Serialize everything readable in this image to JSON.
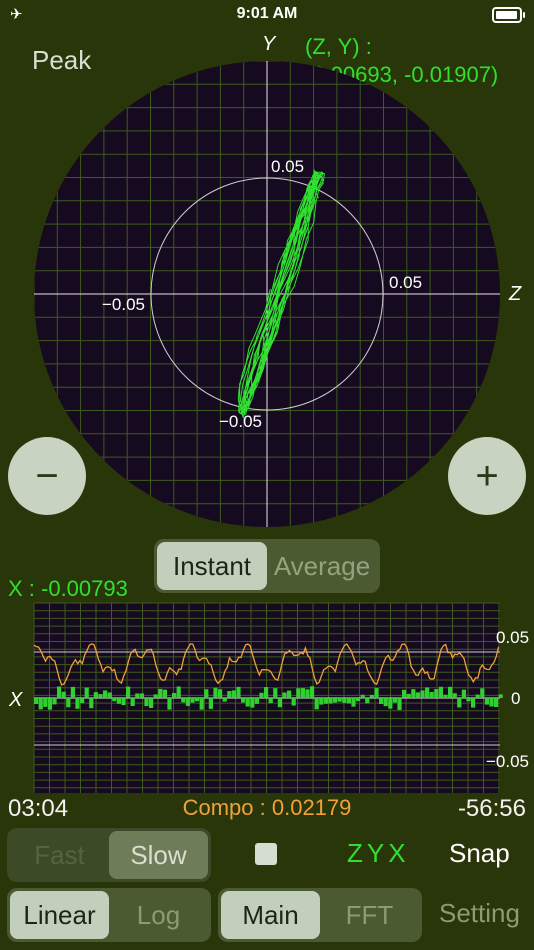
{
  "status": {
    "time": "9:01 AM",
    "left_icons": "✈",
    "battery": 0.95
  },
  "header": {
    "mode_label": "Peak",
    "zy_caption": "(Z, Y) :",
    "zy_value": "(0.00693, -0.01907)"
  },
  "polar": {
    "axis_y": "Y",
    "axis_z": "Z",
    "tick_top": "0.05",
    "tick_right": "0.05",
    "tick_left": "−0.05",
    "tick_bottom": "−0.05"
  },
  "zoom": {
    "minus": "−",
    "plus": "+"
  },
  "mode_toggle": {
    "instant": "Instant",
    "average": "Average",
    "selected": "instant"
  },
  "x_readout": "X : -0.00793",
  "waveform": {
    "axis_x": "X",
    "tick_top": "0.05",
    "tick_mid": "0",
    "tick_bottom": "−0.05"
  },
  "footer": {
    "time_left": "03:04",
    "compo": "Compo : 0.02179",
    "time_right": "-56:56"
  },
  "speed_toggle": {
    "fast": "Fast",
    "slow": "Slow",
    "selected": "slow"
  },
  "axes_button": "ZYX",
  "snap_button": "Snap",
  "scale_toggle": {
    "linear": "Linear",
    "log": "Log",
    "selected": "linear"
  },
  "view_toggle": {
    "main": "Main",
    "fft": "FFT",
    "selected": "main"
  },
  "setting_button": "Setting",
  "colors": {
    "background": "#293609",
    "trace": "#2fe02f",
    "orange": "#f0a13a",
    "plot_bg": "#150a1f"
  }
}
